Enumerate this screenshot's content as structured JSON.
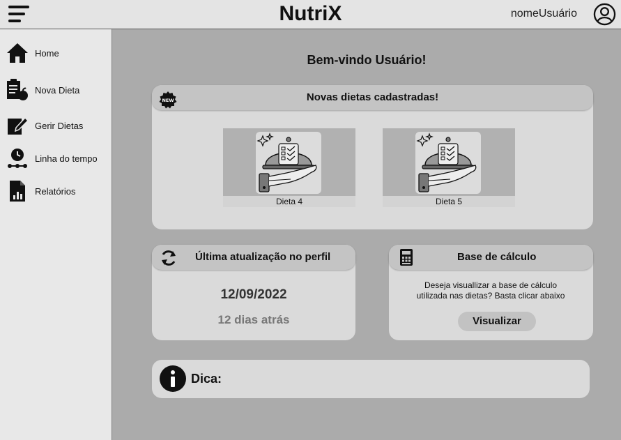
{
  "header": {
    "app_title": "NutriX",
    "username": "nomeUsuário",
    "menu_icon": "hamburger-menu-icon",
    "user_icon": "user-circle-icon"
  },
  "sidebar": {
    "items": [
      {
        "label": "Home",
        "icon": "home-icon"
      },
      {
        "label": "Nova Dieta",
        "icon": "clipboard-apple-icon"
      },
      {
        "label": "Gerir Dietas",
        "icon": "edit-document-icon"
      },
      {
        "label": "Linha do tempo",
        "icon": "timeline-clock-icon"
      },
      {
        "label": "Relatórios",
        "icon": "report-chart-icon"
      }
    ]
  },
  "main": {
    "welcome": "Bem-vindo Usuário!",
    "new_diets": {
      "title": "Novas dietas cadastradas!",
      "badge_icon": "new-badge-icon",
      "diets": [
        {
          "name": "Dieta 4",
          "icon": "serving-cloche-icon"
        },
        {
          "name": "Dieta 5",
          "icon": "serving-cloche-icon"
        }
      ]
    },
    "last_update": {
      "title": "Última atualização no perfil",
      "icon": "refresh-icon",
      "date": "12/09/2022",
      "ago": "12 dias atrás"
    },
    "calc_base": {
      "title": "Base de cálculo",
      "icon": "calculator-icon",
      "description_line1": "Deseja visuallizar a base de cálculo",
      "description_line2": "utilizada nas dietas? Basta clicar abaixo",
      "button": "Visualizar"
    },
    "tip": {
      "label": "Dica:",
      "icon": "info-icon"
    }
  },
  "colors": {
    "background": "#ababab",
    "topbar": "#e4e4e4",
    "sidebar": "#e8e8e8",
    "card": "#dadada",
    "card_header": "#c4c4c4"
  }
}
